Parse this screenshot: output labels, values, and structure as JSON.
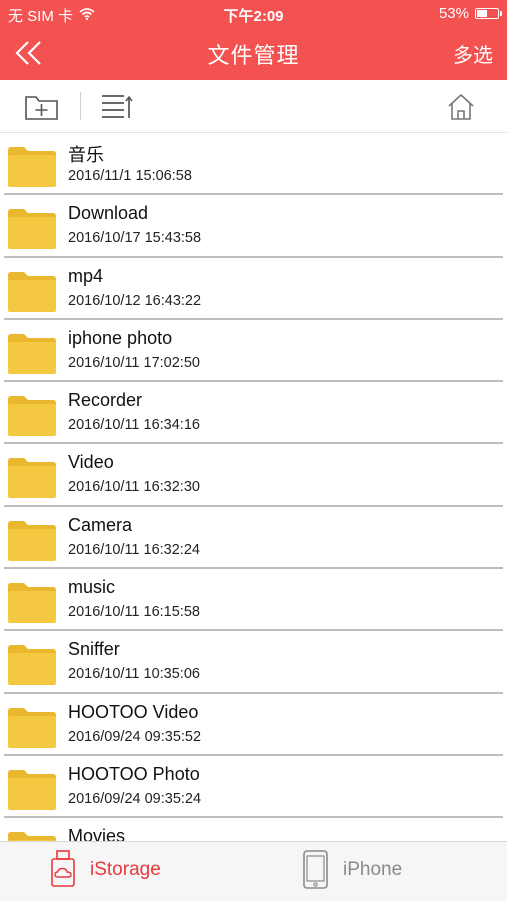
{
  "status": {
    "carrier": "无 SIM 卡",
    "time": "下午2:09",
    "battery": "53%",
    "battery_level": 0.53
  },
  "nav": {
    "title": "文件管理",
    "action": "多选"
  },
  "files": [
    {
      "name": "音乐",
      "date": "2016/11/1 15:06:58"
    },
    {
      "name": "Download",
      "date": "2016/10/17 15:43:58"
    },
    {
      "name": "mp4",
      "date": "2016/10/12 16:43:22"
    },
    {
      "name": "iphone photo",
      "date": "2016/10/11 17:02:50"
    },
    {
      "name": "Recorder",
      "date": "2016/10/11 16:34:16"
    },
    {
      "name": "Video",
      "date": "2016/10/11 16:32:30"
    },
    {
      "name": "Camera",
      "date": "2016/10/11 16:32:24"
    },
    {
      "name": "music",
      "date": "2016/10/11 16:15:58"
    },
    {
      "name": "Sniffer",
      "date": "2016/10/11 10:35:06"
    },
    {
      "name": "HOOTOO Video",
      "date": "2016/09/24 09:35:52"
    },
    {
      "name": "HOOTOO Photo",
      "date": "2016/09/24 09:35:24"
    },
    {
      "name": "Movies",
      "date": ""
    }
  ],
  "tabs": {
    "storage": "iStorage",
    "phone": "iPhone"
  },
  "colors": {
    "accent": "#f45151",
    "active_tab": "#e8383d",
    "folder": "#f5c842"
  },
  "icons": {
    "back": "double-chevron-left-icon",
    "new_folder": "new-folder-icon",
    "sort": "sort-list-icon",
    "home": "home-icon",
    "folder": "folder-icon",
    "storage": "storage-device-icon",
    "phone": "phone-icon"
  }
}
